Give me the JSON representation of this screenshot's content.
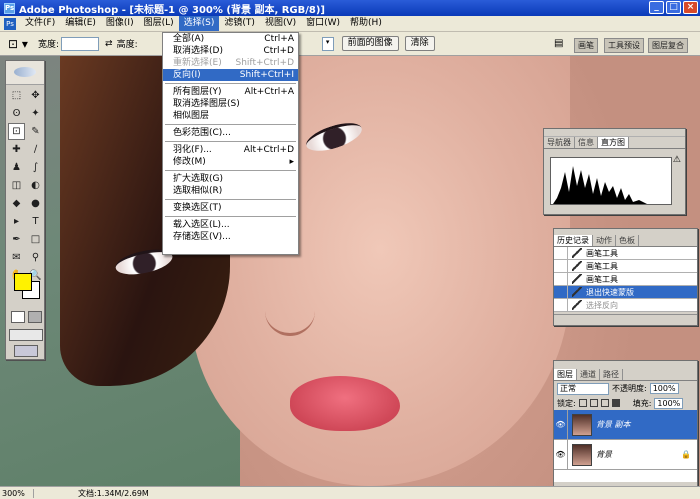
{
  "window": {
    "title": "Adobe Photoshop - [未标题-1 @ 300% (背景 副本, RGB/8)]",
    "app_icon": "Ps",
    "buttons": [
      "_",
      "□",
      "×"
    ]
  },
  "menubar": {
    "items": [
      "文件(F)",
      "编辑(E)",
      "图像(I)",
      "图层(L)",
      "选择(S)",
      "滤镜(T)",
      "视图(V)",
      "窗口(W)",
      "帮助(H)"
    ],
    "active_index": 4
  },
  "options_bar": {
    "width_label": "宽度:",
    "width_value": "",
    "swap_glyph": "⇄",
    "height_label": "高度:",
    "front_image_label": "前面的图像",
    "clear_label": "清除",
    "workspace_tabs": [
      "画笔",
      "工具预设",
      "图层复合"
    ]
  },
  "select_menu": {
    "items": [
      {
        "label": "全部(A)",
        "shortcut": "Ctrl+A",
        "state": "normal"
      },
      {
        "label": "取消选择(D)",
        "shortcut": "Ctrl+D",
        "state": "normal"
      },
      {
        "label": "重新选择(E)",
        "shortcut": "Shift+Ctrl+D",
        "state": "disabled"
      },
      {
        "label": "反向(I)",
        "shortcut": "Shift+Ctrl+I",
        "state": "highlighted"
      },
      {
        "sep": true
      },
      {
        "label": "所有图层(Y)",
        "shortcut": "Alt+Ctrl+A",
        "state": "normal"
      },
      {
        "label": "取消选择图层(S)",
        "shortcut": "",
        "state": "normal"
      },
      {
        "label": "相似图层",
        "shortcut": "",
        "state": "normal"
      },
      {
        "sep": true
      },
      {
        "label": "色彩范围(C)...",
        "shortcut": "",
        "state": "normal"
      },
      {
        "sep": true
      },
      {
        "label": "羽化(F)...",
        "shortcut": "Alt+Ctrl+D",
        "state": "normal"
      },
      {
        "label": "修改(M)",
        "shortcut": "▸",
        "state": "normal"
      },
      {
        "sep": true
      },
      {
        "label": "扩大选取(G)",
        "shortcut": "",
        "state": "normal"
      },
      {
        "label": "选取相似(R)",
        "shortcut": "",
        "state": "normal"
      },
      {
        "sep": true
      },
      {
        "label": "变换选区(T)",
        "shortcut": "",
        "state": "normal"
      },
      {
        "sep": true
      },
      {
        "label": "载入选区(L)...",
        "shortcut": "",
        "state": "normal"
      },
      {
        "label": "存储选区(V)...",
        "shortcut": "",
        "state": "normal"
      }
    ]
  },
  "toolbox": {
    "foreground_color": "#fff200",
    "background_color": "#ffffff",
    "tools": [
      "marquee-icon",
      "move-icon",
      "lasso-icon",
      "magic-wand-icon",
      "crop-icon",
      "slice-icon",
      "healing-icon",
      "brush-icon",
      "stamp-icon",
      "history-brush-icon",
      "eraser-icon",
      "fill-icon",
      "blur-icon",
      "dodge-icon",
      "path-select-icon",
      "type-icon",
      "pen-icon",
      "shape-icon",
      "notes-icon",
      "eyedropper-icon",
      "hand-icon",
      "zoom-icon"
    ],
    "tool_glyphs": [
      "⬚",
      "✥",
      "ʘ",
      "✦",
      "⊡",
      "✎",
      "✚",
      "∕",
      "♟",
      "∫",
      "◫",
      "◐",
      "◆",
      "●",
      "▸",
      "T",
      "✒",
      "□",
      "✉",
      "⚲",
      "✋",
      "🔍"
    ]
  },
  "navigator_panel": {
    "tabs": [
      "导航器",
      "信息",
      "直方图"
    ],
    "active_tab": 2,
    "warning_glyph": "⚠"
  },
  "history_panel": {
    "tabs": [
      "历史记录",
      "动作",
      "色板"
    ],
    "items": [
      {
        "label": "画笔工具",
        "current": false
      },
      {
        "label": "画笔工具",
        "current": false
      },
      {
        "label": "画笔工具",
        "current": false
      },
      {
        "label": "退出快速蒙版",
        "current": true
      },
      {
        "label": "选择反向",
        "current": false,
        "dim": true
      }
    ]
  },
  "layers_panel": {
    "tabs": [
      "图层",
      "通道",
      "路径"
    ],
    "blend_mode": "正常",
    "opacity_label": "不透明度:",
    "opacity_value": "100%",
    "lock_label": "锁定:",
    "fill_label": "填充:",
    "fill_value": "100%",
    "layers": [
      {
        "name": "背景 副本",
        "selected": true,
        "locked": false
      },
      {
        "name": "背景",
        "selected": false,
        "locked": true
      }
    ]
  },
  "statusbar": {
    "zoom": "300%",
    "doc_info": "文档:1.34M/2.69M"
  },
  "colors": {
    "title_blue": "#0a3ab8",
    "menu_highlight": "#316ac5",
    "chrome": "#d4d0c8"
  }
}
